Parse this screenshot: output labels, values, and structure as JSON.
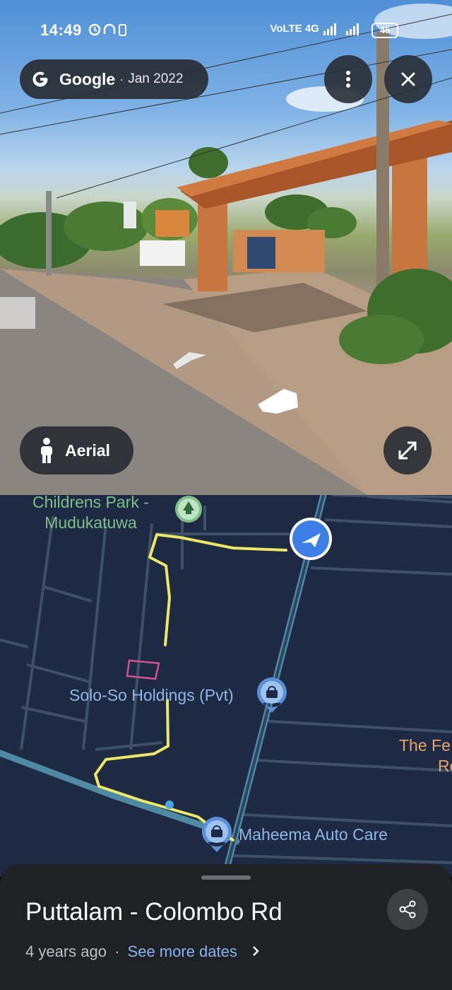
{
  "status_bar": {
    "time": "14:49",
    "network": "VoLTE 4G",
    "battery": "45"
  },
  "street_view": {
    "provider": "Google",
    "date": "Jan 2022",
    "aerial_label": "Aerial"
  },
  "map": {
    "labels": {
      "park_line1": "Childrens Park -",
      "park_line2": "Mudukatuwa",
      "solo": "Solo-So Holdings (Pvt)",
      "maheema": "Maheema Auto Care",
      "fe_line1": "The Fe",
      "fe_line2": "Re"
    },
    "colors": {
      "background": "#1e2a44",
      "road": "#4e8aa4",
      "route": "#ece766",
      "building_outline": "#d0558f",
      "park_marker": "#7fbf8a",
      "poi_marker": "#5b8fd6",
      "location_marker": "#3d7ee6"
    }
  },
  "sheet": {
    "title": "Puttalam - Colombo Rd",
    "age": "4 years ago",
    "dot": "·",
    "see_more": "See more dates"
  }
}
